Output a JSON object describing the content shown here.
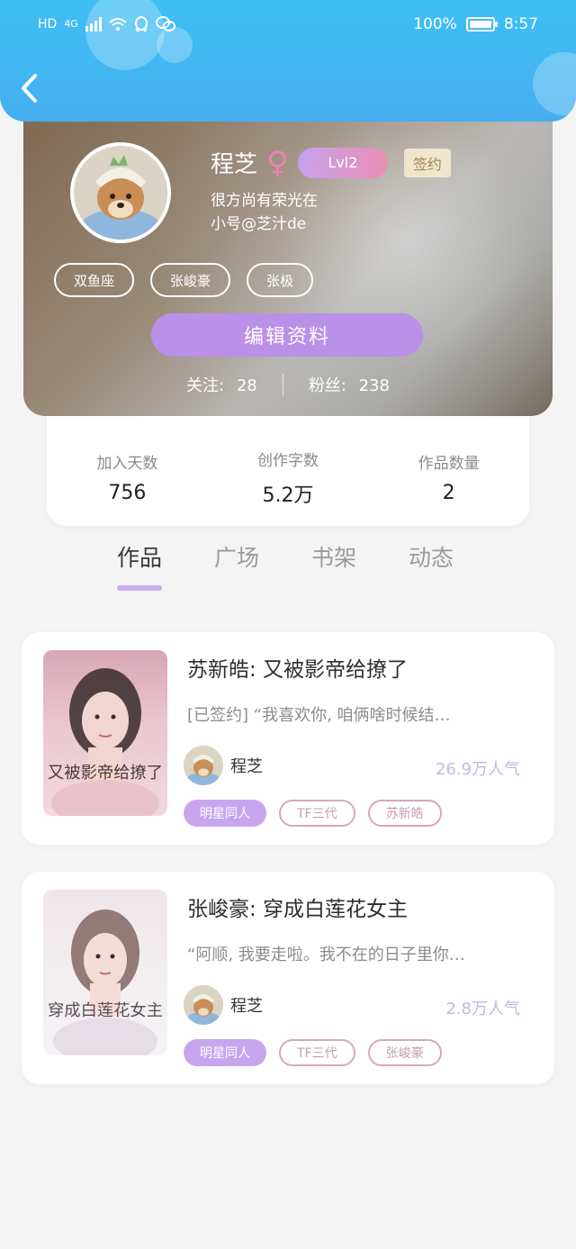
{
  "status_bar": {
    "left_icons": [
      "HD",
      "4G",
      "wifi-icon",
      "qq-icon",
      "wechat-icon"
    ],
    "battery": "100%",
    "battery_level": 1.0,
    "time": "8:57"
  },
  "header": {
    "back_icon": "chevron-left-icon"
  },
  "profile": {
    "name": "程芝",
    "gender_symbol": "♀",
    "level": "Lvl2",
    "signed_badge": "签约",
    "bio_line1": "很方尚有荣光在",
    "bio_line2": "小号@芝汁de",
    "tags": [
      "双鱼座",
      "张峻豪",
      "张极"
    ],
    "edit_button": "编辑资料",
    "follow_label": "关注:",
    "follow_count": "28",
    "fans_label": "粉丝:",
    "fans_count": "238"
  },
  "stats": [
    {
      "label": "加入天数",
      "value": "756"
    },
    {
      "label": "创作字数",
      "value": "5.2万"
    },
    {
      "label": "作品数量",
      "value": "2"
    }
  ],
  "tabs": [
    {
      "label": "作品",
      "active": true
    },
    {
      "label": "广场",
      "active": false
    },
    {
      "label": "书架",
      "active": false
    },
    {
      "label": "动态",
      "active": false
    }
  ],
  "works": [
    {
      "title": "苏新皓: 又被影帝给撩了",
      "desc": "[已签约] “我喜欢你, 咱俩啥时候结…",
      "author": "程芝",
      "popularity": "26.9万人气",
      "tags": [
        "明星同人",
        "TF三代",
        "苏新皓"
      ],
      "cover_text": "又被影帝给撩了"
    },
    {
      "title": "张峻豪: 穿成白莲花女主",
      "desc": "“阿顺, 我要走啦。我不在的日子里你…",
      "author": "程芝",
      "popularity": "2.8万人气",
      "tags": [
        "明星同人",
        "TF三代",
        "张峻豪"
      ],
      "cover_text": "穿成白莲花女主"
    }
  ],
  "colors": {
    "header_blue": "#42b6f1",
    "accent_purple": "#bb90e8",
    "tab_underline": "#c8acf0",
    "popularity": "#c8b5e9",
    "tag_outline": "#d6a8bd"
  }
}
